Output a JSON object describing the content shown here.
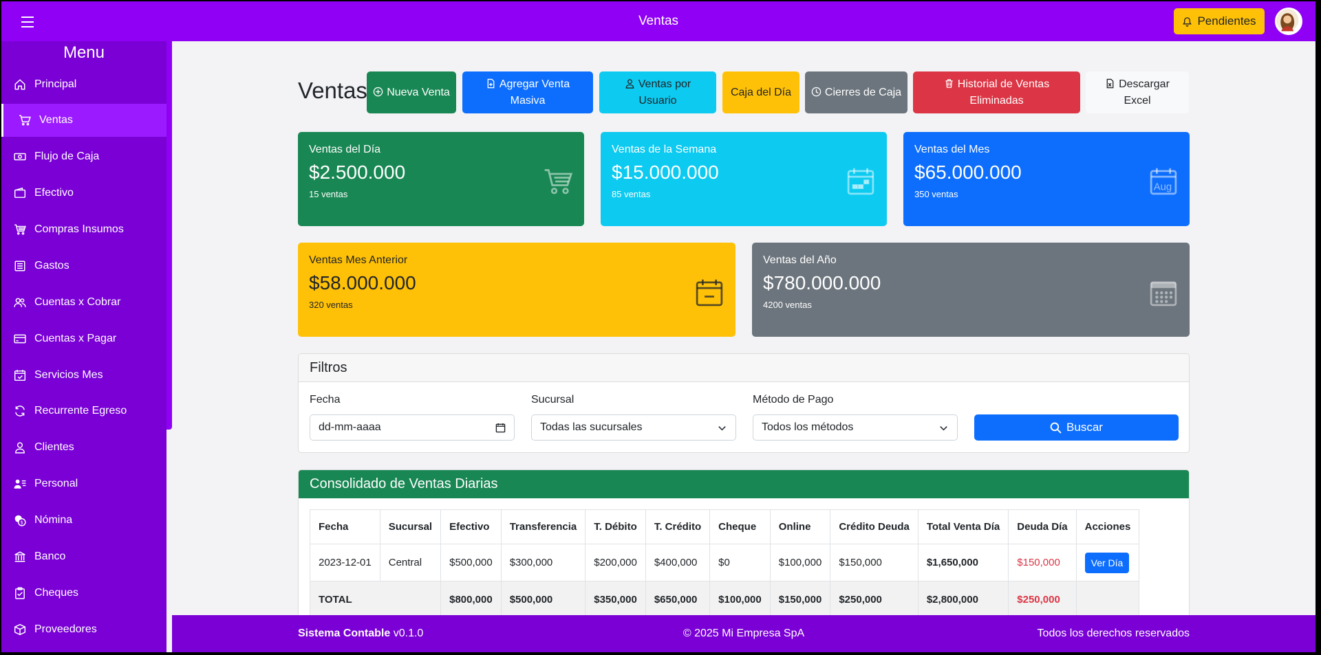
{
  "topbar": {
    "title": "Ventas",
    "pending_label": "Pendientes"
  },
  "sidebar": {
    "title": "Menu",
    "items": [
      {
        "label": "Principal",
        "icon": "house-icon"
      },
      {
        "label": "Ventas",
        "icon": "cart-icon",
        "active": true
      },
      {
        "label": "Flujo de Caja",
        "icon": "cash-icon"
      },
      {
        "label": "Efectivo",
        "icon": "wallet-icon"
      },
      {
        "label": "Compras Insumos",
        "icon": "cart-icon"
      },
      {
        "label": "Gastos",
        "icon": "receipt-icon"
      },
      {
        "label": "Cuentas x Cobrar",
        "icon": "people-icon"
      },
      {
        "label": "Cuentas x Pagar",
        "icon": "credit-card-icon"
      },
      {
        "label": "Servicios Mes",
        "icon": "calendar-check-icon"
      },
      {
        "label": "Recurrente Egreso",
        "icon": "repeat-icon"
      },
      {
        "label": "Clientes",
        "icon": "person-icon"
      },
      {
        "label": "Personal",
        "icon": "person-lines-icon"
      },
      {
        "label": "Nómina",
        "icon": "coins-icon"
      },
      {
        "label": "Banco",
        "icon": "bank-icon"
      },
      {
        "label": "Cheques",
        "icon": "clipboard-check-icon"
      },
      {
        "label": "Proveedores",
        "icon": "box-icon"
      }
    ]
  },
  "main": {
    "title": "Ventas",
    "actions": [
      {
        "label": "Nueva Venta",
        "icon": "plus-circle-icon",
        "color": "#198754"
      },
      {
        "label": "Agregar Venta Masiva",
        "icon": "file-plus-icon",
        "color": "#0d6efd"
      },
      {
        "label": "Ventas por Usuario",
        "icon": "person-icon",
        "color": "#0dcaf0"
      },
      {
        "label": "Caja del Día",
        "icon": "",
        "color": "#ffc107"
      },
      {
        "label": "Cierres de Caja",
        "icon": "clock-icon",
        "color": "#6c757d"
      },
      {
        "label": "Historial de Ventas Eliminadas",
        "icon": "trash-icon",
        "color": "#dc3545"
      },
      {
        "label": "Descargar Excel",
        "icon": "file-excel-icon",
        "color": "#f8f9fa"
      }
    ],
    "cards": [
      {
        "title": "Ventas del Día",
        "value": "$2.500.000",
        "sub": "15 ventas",
        "color": "#198754",
        "icon": "cart-icon"
      },
      {
        "title": "Ventas de la Semana",
        "value": "$15.000.000",
        "sub": "85 ventas",
        "color": "#0dcaf0",
        "icon": "calendar-week-icon"
      },
      {
        "title": "Ventas del Mes",
        "value": "$65.000.000",
        "sub": "350 ventas",
        "color": "#0d6efd",
        "icon": "calendar-month-icon",
        "icon_text": "Aug"
      },
      {
        "title": "Ventas Mes Anterior",
        "value": "$58.000.000",
        "sub": "320 ventas",
        "color": "#ffc107",
        "icon": "calendar-minus-icon"
      },
      {
        "title": "Ventas del Año",
        "value": "$780.000.000",
        "sub": "4200 ventas",
        "color": "#6c757d",
        "icon": "calendar-grid-icon"
      }
    ],
    "filters": {
      "title": "Filtros",
      "fecha_label": "Fecha",
      "fecha_placeholder": "dd-mm-aaaa",
      "sucursal_label": "Sucursal",
      "sucursal_value": "Todas las sucursales",
      "metodo_label": "Método de Pago",
      "metodo_value": "Todos los métodos",
      "buscar_label": "Buscar"
    },
    "consolidado": {
      "title": "Consolidado de Ventas Diarias",
      "headers": [
        "Fecha",
        "Sucursal",
        "Efectivo",
        "Transferencia",
        "T. Débito",
        "T. Crédito",
        "Cheque",
        "Online",
        "Crédito Deuda",
        "Total Venta Día",
        "Deuda Día",
        "Acciones"
      ],
      "rows": [
        {
          "fecha": "2023-12-01",
          "sucursal": "Central",
          "efectivo": "$500,000",
          "transferencia": "$300,000",
          "debito": "$200,000",
          "credito": "$400,000",
          "cheque": "$0",
          "online": "$100,000",
          "credito_deuda": "$150,000",
          "total": "$1,650,000",
          "deuda": "$150,000",
          "accion": "Ver Día"
        }
      ],
      "total": {
        "label": "TOTAL",
        "efectivo": "$800,000",
        "transferencia": "$500,000",
        "debito": "$350,000",
        "credito": "$650,000",
        "cheque": "$100,000",
        "online": "$150,000",
        "credito_deuda": "$250,000",
        "total": "$2,800,000",
        "deuda": "$250,000"
      }
    }
  },
  "footer": {
    "brand": "Sistema Contable",
    "version": "v0.1.0",
    "copyright": "© 2025 Mi Empresa SpA",
    "rights": "Todos los derechos reservados"
  }
}
